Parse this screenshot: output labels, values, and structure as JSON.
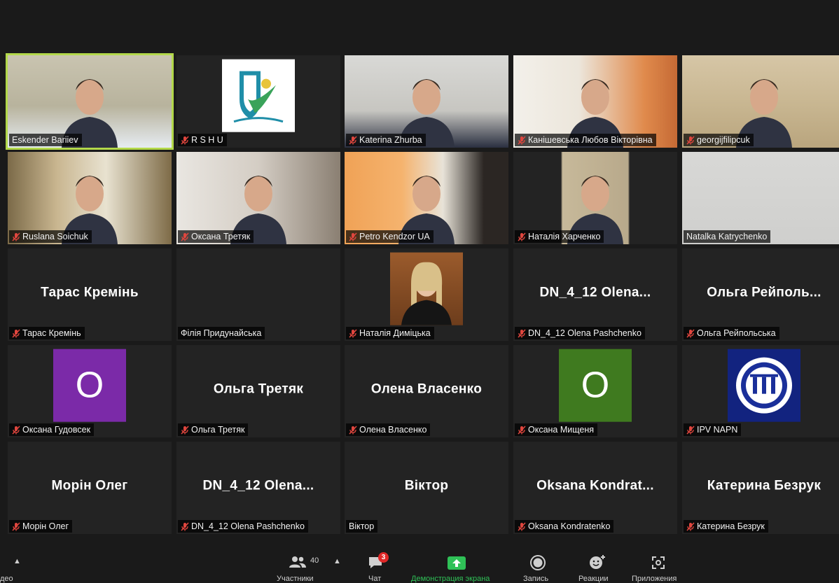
{
  "participants": [
    {
      "name": "Eskender Bariiev",
      "muted": false,
      "active": true,
      "kind": "video"
    },
    {
      "name": "R S H U",
      "muted": true,
      "kind": "logo-rshu"
    },
    {
      "name": "Katerina Zhurba",
      "muted": true,
      "kind": "video"
    },
    {
      "name": "Канішевська Любов Вікторівна",
      "muted": true,
      "kind": "video"
    },
    {
      "name": "georgijfilipcuk",
      "muted": true,
      "kind": "video"
    },
    {
      "name": "Ruslana Soichuk",
      "muted": true,
      "kind": "video"
    },
    {
      "name": "Оксана Третяк",
      "muted": true,
      "kind": "video"
    },
    {
      "name": "Petro Kendzor UA",
      "muted": true,
      "kind": "video"
    },
    {
      "name": "Наталія Харченко",
      "muted": true,
      "kind": "video"
    },
    {
      "name": "Natalka Katrychenko",
      "muted": false,
      "kind": "video"
    },
    {
      "name": "Тарас Кремінь",
      "display": "Тарас Кремінь",
      "muted": true,
      "kind": "text"
    },
    {
      "name": "Філія Придунайська",
      "display": "",
      "muted": false,
      "kind": "text"
    },
    {
      "name": "Наталія Диміцька",
      "muted": true,
      "kind": "photo"
    },
    {
      "name": "DN_4_12 Olena Pashchenko",
      "display": "DN_4_12  Olena...",
      "muted": true,
      "kind": "text"
    },
    {
      "name": "Ольга Рейпольська",
      "display": "Ольга  Рейполь...",
      "muted": true,
      "kind": "text"
    },
    {
      "name": "Оксана Гудовсек",
      "initial": "O",
      "avatar_color": "#7b2aa8",
      "muted": true,
      "kind": "avatar"
    },
    {
      "name": "Ольга Третяк",
      "display": "Ольга Третяк",
      "muted": true,
      "kind": "text"
    },
    {
      "name": "Олена Власенко",
      "display": "Олена Власенко",
      "muted": true,
      "kind": "text"
    },
    {
      "name": "Оксана Мищеня",
      "initial": "O",
      "avatar_color": "#3f7a1f",
      "muted": true,
      "kind": "avatar"
    },
    {
      "name": "IPV NAPN",
      "muted": true,
      "kind": "logo-ipv"
    },
    {
      "name": "Морін Олег",
      "display": "Морін Олег",
      "muted": true,
      "kind": "text"
    },
    {
      "name": "DN_4_12 Olena Pashchenko",
      "display": "DN_4_12  Olena...",
      "muted": true,
      "kind": "text"
    },
    {
      "name": "Віктор",
      "display": "Віктор",
      "muted": false,
      "kind": "text"
    },
    {
      "name": "Oksana Kondratenko",
      "display": "Oksana  Kondrat...",
      "muted": true,
      "kind": "text"
    },
    {
      "name": "Катерина Безрук",
      "display": "Катерина Безрук",
      "muted": true,
      "kind": "text"
    }
  ],
  "toolbar": {
    "video_label": "део",
    "participants_label": "Участники",
    "participants_count": "40",
    "chat_label": "Чат",
    "chat_badge": "3",
    "share_label": "Демонстрация экрана",
    "record_label": "Запись",
    "reactions_label": "Реакции",
    "apps_label": "Приложения"
  },
  "colors": {
    "active_border": "#b3d84a",
    "share_green": "#2fc157",
    "badge_red": "#e02828"
  }
}
